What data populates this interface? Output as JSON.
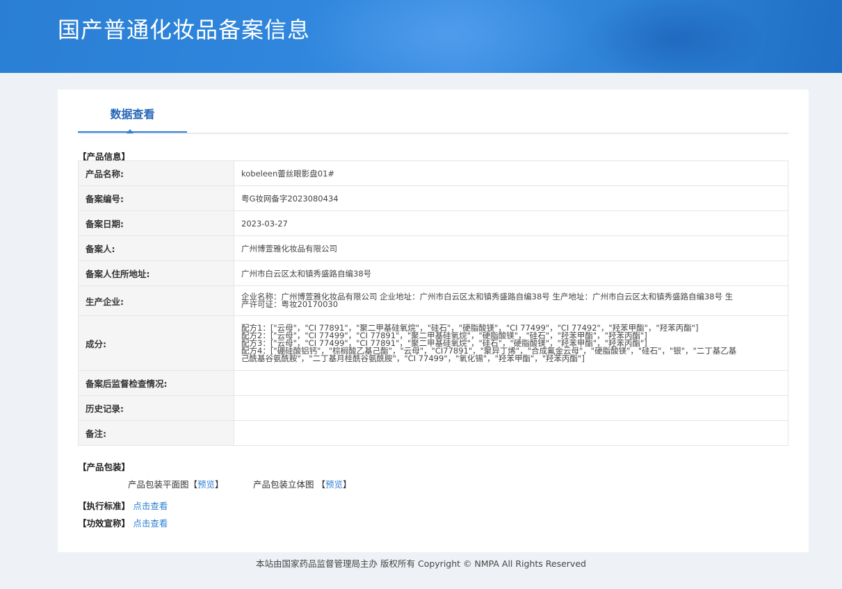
{
  "header": {
    "title": "国产普通化妆品备案信息"
  },
  "tab": {
    "label": "数据查看"
  },
  "sections": {
    "product_info": "【产品信息】",
    "packaging": "【产品包装】",
    "standard": "【执行标准】",
    "efficacy": "【功效宣称】"
  },
  "product": {
    "rows": [
      {
        "label": "产品名称:",
        "value": "kobeleen蕾丝眼影盘01#"
      },
      {
        "label": "备案编号:",
        "value": "粤G妆网备字2023080434"
      },
      {
        "label": "备案日期:",
        "value": "2023-03-27"
      },
      {
        "label": "备案人:",
        "value": "广州博萱雅化妆品有限公司"
      },
      {
        "label": "备案人住所地址:",
        "value": "广州市白云区太和镇秀盛路自编38号"
      },
      {
        "label": "生产企业:",
        "value_lines": [
          "企业名称：广州博萱雅化妆品有限公司 企业地址：广州市白云区太和镇秀盛路自编38号 生产地址：广州市白云区太和镇秀盛路自编38号 生",
          "产许可证：粤妆20170030"
        ]
      },
      {
        "label": "成分:",
        "value_lines": [
          "配方1：[\"云母\"，\"CI 77891\"，\"聚二甲基硅氧烷\"，\"硅石\"，\"硬脂酸镁\"，\"CI 77499\"，\"CI 77492\"，\"羟苯甲酯\"，\"羟苯丙酯\"]",
          "配方2：[\"云母\"，\"CI 77499\"，\"CI 77891\"，\"聚二甲基硅氧烷\"，\"硬脂酸镁\"，\"硅石\"，\"羟苯甲酯\"，\"羟苯丙酯\"]",
          "配方3：[\"云母\"，\"CI 77499\"，\"CI 77891\"，\"聚二甲基硅氧烷\"，\"硅石\"，\"硬脂酸镁\"，\"羟苯甲酯\"，\"羟苯丙酯\"]",
          "配方4：[\"硼硅酸铝钙\"，\"棕榈酸乙基己酯\"，\"云母\"，\"CI77891\"，\"聚异丁烯\"，\"合成氟金云母\"，\"硬脂酸镁\"，\"硅石\"，\"银\"，\"二丁基乙基",
          "己酰基谷氨酰胺\"，\"二丁基月桂酰谷氨酰胺\"，\"CI 77499\"，\"氧化锡\"，\"羟苯甲酯\"，\"羟苯丙酯\"]"
        ]
      },
      {
        "label": "备案后监督检查情况:",
        "value": ""
      },
      {
        "label": "历史记录:",
        "value": ""
      },
      {
        "label": "备注:",
        "value": ""
      }
    ]
  },
  "packaging": {
    "flat_label": "产品包装平面图",
    "flat_link": "预览",
    "stereo_label": "产品包装立体图",
    "stereo_link": "预览",
    "bracket_open": "【",
    "bracket_close": "】"
  },
  "links": {
    "standard": "点击查看",
    "efficacy": "点击查看"
  },
  "footer": {
    "text": "本站由国家药品监督管理局主办 版权所有 Copyright © NMPA All Rights Reserved"
  }
}
